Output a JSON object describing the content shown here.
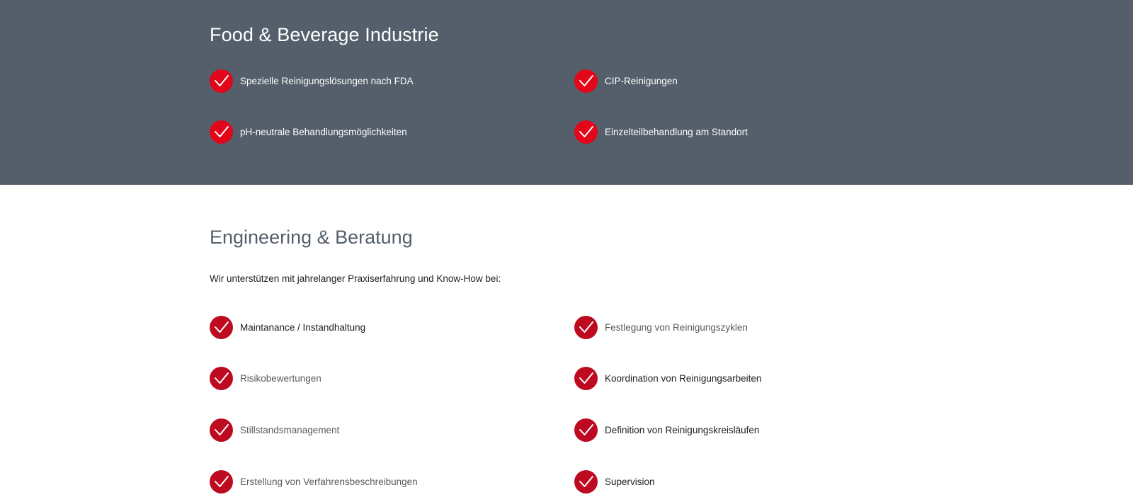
{
  "food_section": {
    "title": "Food & Beverage Industrie",
    "items": [
      {
        "label": "Spezielle Reinigungslösungen nach FDA"
      },
      {
        "label": "CIP-Reinigungen"
      },
      {
        "label": "pH-neutrale Behandlungsmöglichkeiten"
      },
      {
        "label": "Einzelteilbehandlung am Standort"
      }
    ]
  },
  "engineering_section": {
    "title": "Engineering & Beratung",
    "intro": "Wir unterstützen mit jahrelanger Praxiserfahrung und Know-How bei:",
    "items": [
      {
        "label": "Maintanance / Instandhaltung"
      },
      {
        "label": "Festlegung von Reinigungszyklen"
      },
      {
        "label": "Risikobewertungen"
      },
      {
        "label": "Koordination von Reinigungsarbeiten"
      },
      {
        "label": "Stillstandsmanagement"
      },
      {
        "label": "Definition von Reinigungskreisläufen"
      },
      {
        "label": "Erstellung von Verfahrensbeschreibungen"
      },
      {
        "label": "Supervision"
      }
    ]
  },
  "colors": {
    "band_background": "#545f6b",
    "check_red": "#e30518",
    "check_dark_red": "#bd0a20"
  },
  "icons": {
    "bullet": "checkmark-icon"
  }
}
